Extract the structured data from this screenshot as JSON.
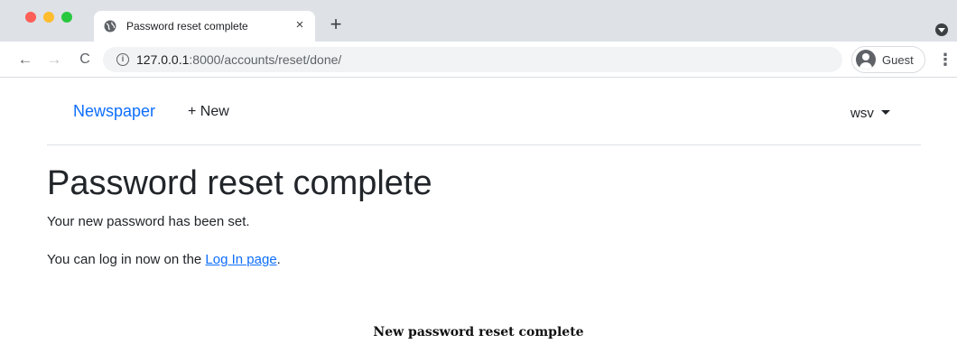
{
  "browser": {
    "tab_title": "Password reset complete",
    "tab_close": "×",
    "new_tab": "+",
    "back": "←",
    "forward": "→",
    "reload": "C",
    "url_host": "127.0.0.1",
    "url_path": ":8000/accounts/reset/done/",
    "profile_label": "Guest",
    "menu": "⋮"
  },
  "navbar": {
    "brand": "Newspaper",
    "new_link": "+ New",
    "user": "wsv"
  },
  "main": {
    "title": "Password reset complete",
    "message": "Your new password has been set.",
    "login_prefix": "You can log in now on the ",
    "login_link": "Log In page",
    "login_suffix": "."
  },
  "caption": "New password reset complete",
  "colors": {
    "link": "#0d6efd",
    "text": "#212529",
    "tabbar": "#dee1e6"
  }
}
